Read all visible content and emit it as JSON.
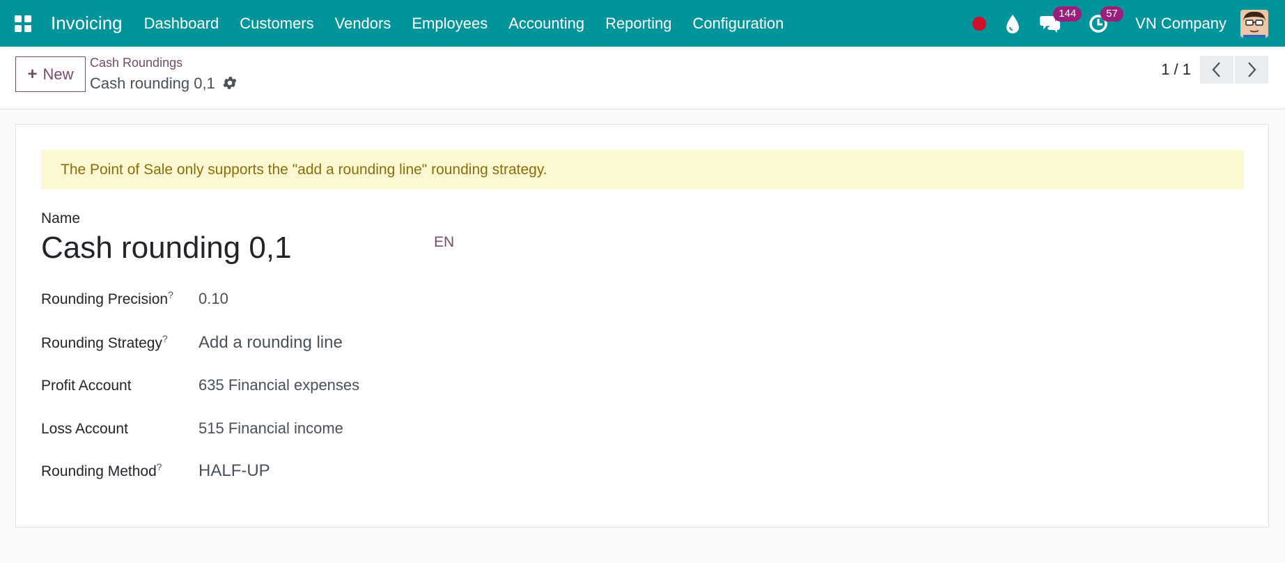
{
  "navbar": {
    "app_name": "Invoicing",
    "menu": [
      "Dashboard",
      "Customers",
      "Vendors",
      "Employees",
      "Accounting",
      "Reporting",
      "Configuration"
    ],
    "messages_count": "144",
    "activities_count": "57",
    "company": "VN Company",
    "record_color": "#d0112b"
  },
  "control": {
    "new_label": "New",
    "breadcrumb": "Cash Roundings",
    "record_title": "Cash rounding 0,1",
    "pager": "1 / 1"
  },
  "form": {
    "alert": "The Point of Sale only supports the \"add a rounding line\" rounding strategy.",
    "name_label": "Name",
    "name_value": "Cash rounding 0,1",
    "lang": "EN",
    "fields": [
      {
        "label": "Rounding Precision",
        "help": "?",
        "value": "0.10"
      },
      {
        "label": "Rounding Strategy",
        "help": "?",
        "value": "Add a rounding line"
      },
      {
        "label": "Profit Account",
        "help": "",
        "value": "635 Financial expenses"
      },
      {
        "label": "Loss Account",
        "help": "",
        "value": "515 Financial income"
      },
      {
        "label": "Rounding Method",
        "help": "?",
        "value": "HALF-UP"
      }
    ]
  },
  "icons": {
    "apps": "apps-grid-icon",
    "record": "record-dot-icon",
    "drop": "drop-icon",
    "chat": "chat-icon",
    "activity": "clock-icon",
    "gear": "gear-icon",
    "prev": "chevron-left-icon",
    "next": "chevron-right-icon"
  },
  "colors": {
    "navbar": "#01949a",
    "primary": "#714b67",
    "alert_bg": "#fcf8d1",
    "alert_text": "#8a6d0b",
    "badge": "#9a1f7a"
  }
}
